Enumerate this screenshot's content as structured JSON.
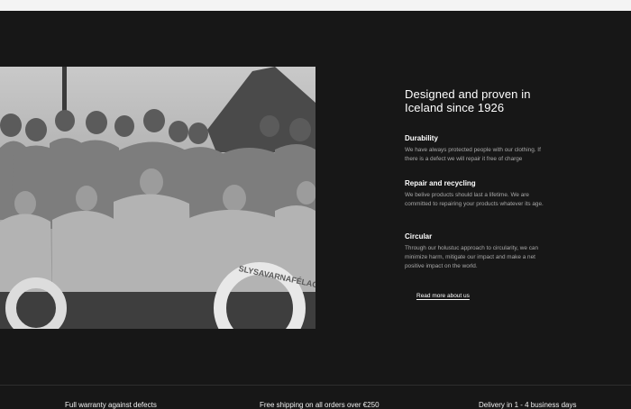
{
  "hero": {
    "heading": "Designed and proven in Iceland since 1926",
    "photo_lifebuoy_text": "SLYSAVARNAFÉLAG"
  },
  "features": [
    {
      "title": "Durability",
      "text": "We have always protected people with our clothing. If there is a defect we will repair it free of charge"
    },
    {
      "title": "Repair and recycling",
      "text": "We belive products should last a lifetime. We are committed to repairing your products whatever its age."
    },
    {
      "title": "Circular",
      "text": "Through our holustuc approach to circularity, we can minimize harm, mitigate our impact and make a net positive impact on the world."
    }
  ],
  "read_more_label": "Read more about us",
  "footer": {
    "items": [
      "Full warranty against defects",
      "Free shipping on all orders over €250",
      "Delivery in 1 - 4 business days"
    ]
  },
  "colors": {
    "background": "#171717",
    "text": "#ffffff",
    "muted_text": "#a8a8a8"
  }
}
